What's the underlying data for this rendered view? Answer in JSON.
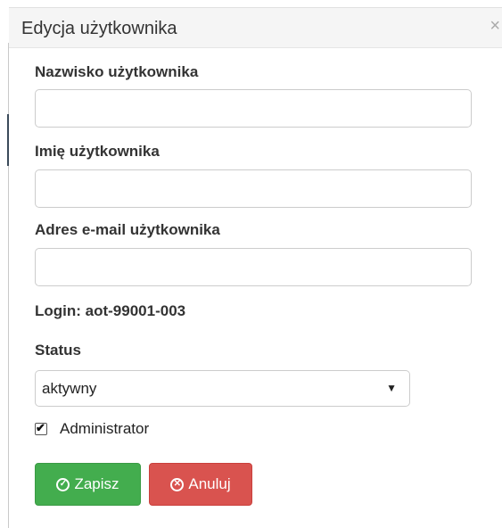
{
  "dialog": {
    "title": "Edycja użytkownika",
    "close_symbol": "×",
    "close_icon": "close-icon"
  },
  "form": {
    "last_name_label": "Nazwisko użytkownika",
    "last_name_value": "",
    "first_name_label": "Imię użytkownika",
    "first_name_value": "",
    "email_label": "Adres e-mail użytkownika",
    "email_value": "",
    "login_text": "Login: aot-99001-003",
    "status_label": "Status",
    "status_selected": "aktywny",
    "status_caret": "▼",
    "admin_checkbox_label": "Administrator",
    "admin_checked": true,
    "check_symbol": "✔"
  },
  "buttons": {
    "save_label": "Zapisz",
    "save_icon": "check-circle-icon",
    "save_icon_glyph": "✓",
    "cancel_label": "Anuluj",
    "cancel_icon": "times-circle-icon",
    "cancel_icon_glyph": "✕"
  },
  "colors": {
    "save_button": "#43ad4e",
    "cancel_button": "#d9534f",
    "header_bg": "#f5f5f5"
  }
}
